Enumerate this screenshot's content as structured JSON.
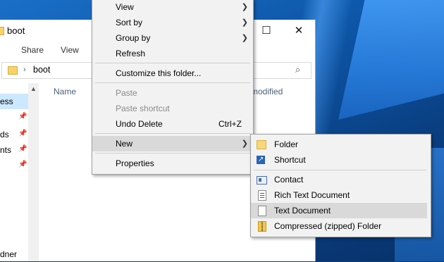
{
  "explorer": {
    "title": "boot",
    "ribbon_tabs": [
      "Share",
      "View"
    ],
    "address_path": "boot",
    "columns": {
      "name": "Name",
      "modified": "modified"
    },
    "nav_items": [
      "ess",
      "ds",
      "nts",
      "",
      "dner"
    ],
    "window_buttons": {
      "maximize": "☐",
      "close": "✕"
    }
  },
  "context_menu": {
    "items": [
      {
        "label": "View",
        "submenu": true
      },
      {
        "label": "Sort by",
        "submenu": true
      },
      {
        "label": "Group by",
        "submenu": true
      },
      {
        "label": "Refresh"
      },
      {
        "label": "Customize this folder..."
      },
      {
        "label": "Paste",
        "disabled": true
      },
      {
        "label": "Paste shortcut",
        "disabled": true
      },
      {
        "label": "Undo Delete",
        "shortcut": "Ctrl+Z"
      },
      {
        "label": "New",
        "submenu": true,
        "highlighted": true
      },
      {
        "label": "Properties"
      }
    ]
  },
  "new_submenu": {
    "items": [
      {
        "label": "Folder",
        "icon": "folder-icon"
      },
      {
        "label": "Shortcut",
        "icon": "shortcut-icon"
      },
      {
        "label": "Contact",
        "icon": "contact-icon"
      },
      {
        "label": "Rich Text Document",
        "icon": "rich-text-document-icon"
      },
      {
        "label": "Text Document",
        "icon": "text-document-icon",
        "highlighted": true
      },
      {
        "label": "Compressed (zipped) Folder",
        "icon": "zip-folder-icon"
      }
    ]
  },
  "colors": {
    "menu_bg": "#f2f2f2",
    "menu_highlight": "#d9d9d9",
    "disabled_text": "#8a8a8a",
    "nav_selected": "#cce8ff",
    "desktop_blue": "#0d56a8"
  }
}
